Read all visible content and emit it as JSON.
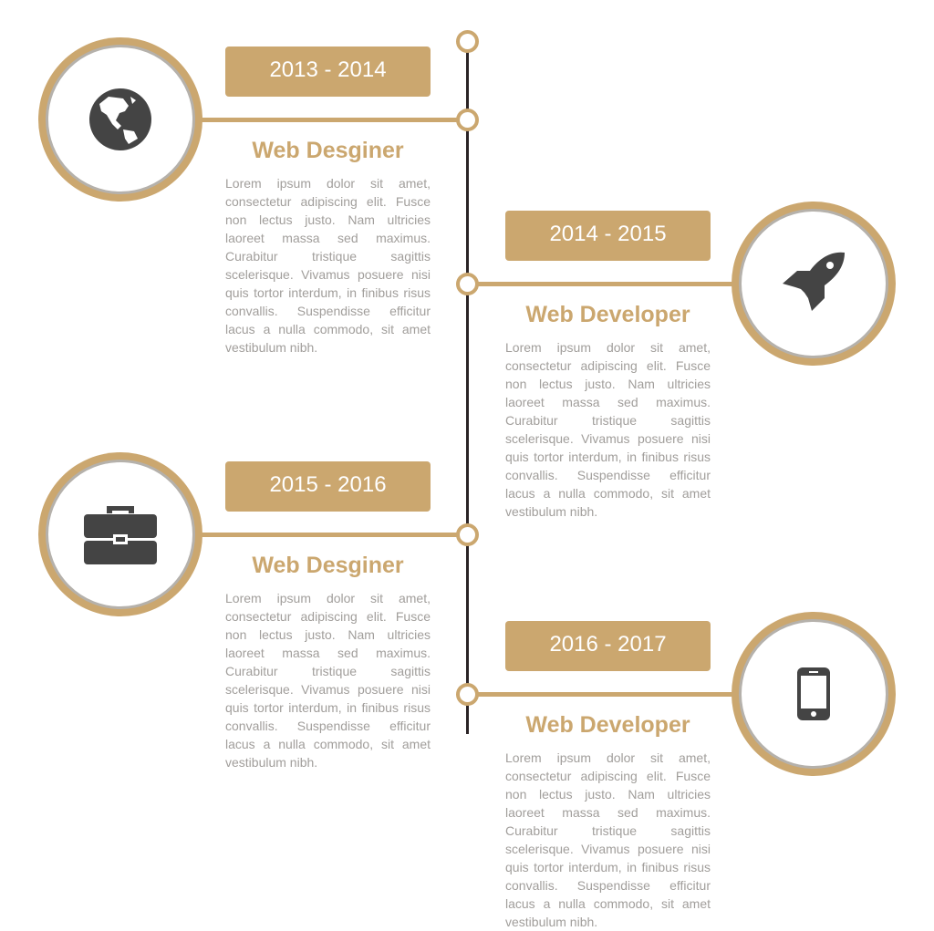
{
  "accent": "#cba76f",
  "timeline": [
    {
      "years": "2013 - 2014",
      "title": "Web Desginer",
      "icon": "globe-icon",
      "text": "Lorem ipsum dolor sit amet, consectetur adipiscing elit. Fusce non lectus justo. Nam ultricies laoreet massa sed maximus. Curabitur tristique sagittis scelerisque. Vivamus posuere nisi quis tortor interdum, in finibus risus convallis. Suspendisse efficitur lacus a nulla commodo, sit amet vestibulum nibh."
    },
    {
      "years": "2014 - 2015",
      "title": "Web Developer",
      "icon": "rocket-icon",
      "text": "Lorem ipsum dolor sit amet, consectetur adipiscing elit. Fusce non lectus justo. Nam ultricies laoreet massa sed maximus. Curabitur tristique sagittis scelerisque. Vivamus posuere nisi quis tortor interdum, in finibus risus convallis. Suspendisse efficitur lacus a nulla commodo, sit amet vestibulum nibh."
    },
    {
      "years": "2015 - 2016",
      "title": "Web Desginer",
      "icon": "briefcase-icon",
      "text": "Lorem ipsum dolor sit amet, consectetur adipiscing elit. Fusce non lectus justo. Nam ultricies laoreet massa sed maximus. Curabitur tristique sagittis scelerisque. Vivamus posuere nisi quis tortor interdum, in finibus risus convallis. Suspendisse efficitur lacus a nulla commodo, sit amet vestibulum nibh."
    },
    {
      "years": "2016 - 2017",
      "title": "Web Developer",
      "icon": "mobile-phone-icon",
      "text": "Lorem ipsum dolor sit amet, consectetur adipiscing elit. Fusce non lectus justo. Nam ultricies laoreet massa sed maximus. Curabitur tristique sagittis scelerisque. Vivamus posuere nisi quis tortor interdum, in finibus risus convallis. Suspendisse efficitur lacus a nulla commodo, sit amet vestibulum nibh."
    }
  ]
}
